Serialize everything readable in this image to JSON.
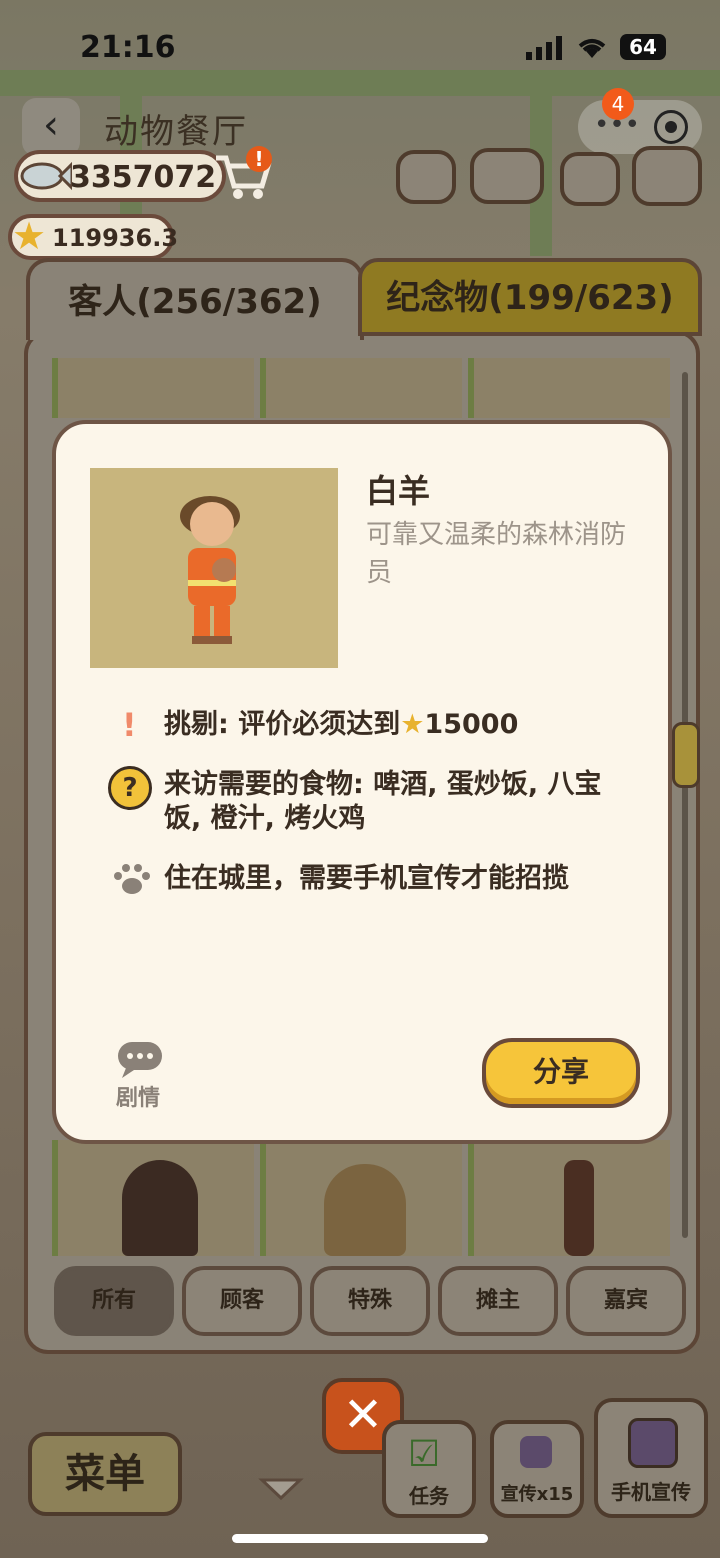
{
  "status_bar": {
    "time": "21:16",
    "battery": "64"
  },
  "header": {
    "back": "‹",
    "title": "动物餐厅",
    "notification_count": "4"
  },
  "resources": {
    "fish": "3357072",
    "stars": "119936.3",
    "cart_alert": "!"
  },
  "tabs": [
    {
      "label": "客人(256/362)",
      "active": true
    },
    {
      "label": "纪念物(199/623)",
      "active": false
    }
  ],
  "modal": {
    "name": "白羊",
    "description": "可靠又温柔的森林消防员",
    "requirement_text": "挑剔: 评价必须达到",
    "requirement_value": "15000",
    "food_text": "来访需要的食物: 啤酒, 蛋炒饭, 八宝饭, 橙汁, 烤火鸡",
    "location_text": "住在城里，需要手机宣传才能招揽",
    "story_label": "剧情",
    "share_label": "分享"
  },
  "filters": [
    {
      "label": "所有",
      "active": true
    },
    {
      "label": "顾客",
      "active": false
    },
    {
      "label": "特殊",
      "active": false
    },
    {
      "label": "摊主",
      "active": false
    },
    {
      "label": "嘉宾",
      "active": false
    }
  ],
  "bottom_bar": {
    "menu": "菜单",
    "close": "✕",
    "tasks": "任务",
    "promote": "宣传x15",
    "phone_promote": "手机宣传"
  },
  "colors": {
    "modal_bg": "#fcf6ea",
    "accent": "#f6c53a",
    "badge": "#f25a1a",
    "border": "#6e5546"
  }
}
